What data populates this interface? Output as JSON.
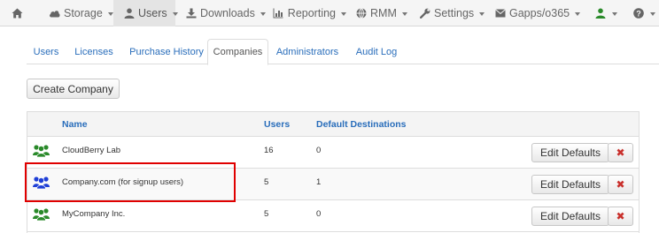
{
  "navbar": {
    "home_icon": "home-icon",
    "items": [
      {
        "label": "Storage",
        "icon": "cloud-icon"
      },
      {
        "label": "Users",
        "icon": "user-icon"
      },
      {
        "label": "Downloads",
        "icon": "download-icon"
      },
      {
        "label": "Reporting",
        "icon": "bar-chart-icon"
      },
      {
        "label": "RMM",
        "icon": "globe-icon"
      },
      {
        "label": "Settings",
        "icon": "wrench-icon"
      },
      {
        "label": "Gapps/o365",
        "icon": "envelope-icon"
      }
    ],
    "active_index": 1,
    "account_icon": "user-green-icon",
    "help_icon": "question-icon"
  },
  "tabs": [
    {
      "label": "Users"
    },
    {
      "label": "Licenses"
    },
    {
      "label": "Purchase History"
    },
    {
      "label": "Companies"
    },
    {
      "label": "Administrators"
    },
    {
      "label": "Audit Log"
    }
  ],
  "active_tab": "Companies",
  "create_button": "Create Company",
  "table": {
    "headers": {
      "name": "Name",
      "users": "Users",
      "destinations": "Default Destinations"
    },
    "edit_label": "Edit Defaults",
    "delete_label": "✖",
    "rows": [
      {
        "name": "CloudBerry Lab",
        "users": "16",
        "destinations": "0",
        "icon": "users-group-icon",
        "icon_color": "#2a8a2a"
      },
      {
        "name": "Company.com (for signup users)",
        "users": "5",
        "destinations": "1",
        "icon": "users-group-icon",
        "icon_color": "#1f3fd6"
      },
      {
        "name": "MyCompany Inc.",
        "users": "5",
        "destinations": "0",
        "icon": "users-group-icon",
        "icon_color": "#2a8a2a"
      }
    ]
  },
  "colors": {
    "link": "#2a6ebb",
    "highlight": "#e00000",
    "delete": "#c9302c"
  }
}
